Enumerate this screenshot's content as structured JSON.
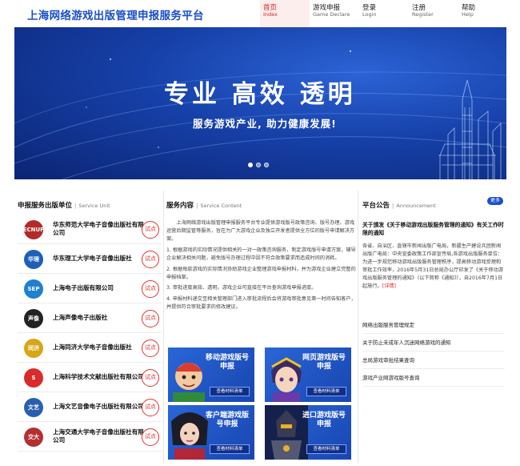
{
  "header": {
    "site_title": "上海网络游戏出版管理申报服务平台",
    "nav": [
      {
        "cn": "首页",
        "en": "Index"
      },
      {
        "cn": "游戏申报",
        "en": "Game Declare"
      },
      {
        "cn": "登录",
        "en": "Login"
      },
      {
        "cn": "注册",
        "en": "Register"
      },
      {
        "cn": "帮助",
        "en": "Help"
      }
    ]
  },
  "banner": {
    "slogan": "专业 高效 透明",
    "subtitle": "服务游戏产业, 助力健康发展!",
    "slide_count": 3,
    "active_slide": 1
  },
  "units": {
    "title_cn": "申报服务出版单位",
    "title_en": "Service Unit",
    "trial_label": "试点",
    "items": [
      {
        "name": "华东师范大学电子音像出版社有限公司",
        "logo_text": "ECNUP",
        "logo_color": "#b22b2b"
      },
      {
        "name": "华东理工大学电子音像出版社",
        "logo_text": "华理",
        "logo_color": "#1f5fb8"
      },
      {
        "name": "上海电子出版有限公司",
        "logo_text": "SEP",
        "logo_color": "#1f7fd0"
      },
      {
        "name": "上海声像电子出版社",
        "logo_text": "声像",
        "logo_color": "#222222"
      },
      {
        "name": "上海同济大学电子音像出版社",
        "logo_text": "同济",
        "logo_color": "#d8a516"
      },
      {
        "name": "上海科学技术文献出版社有限公司",
        "logo_text": "S",
        "logo_color": "#d92b2b"
      },
      {
        "name": "上海文艺音像电子出版社有限公司",
        "logo_text": "文艺",
        "logo_color": "#2a5fb0"
      },
      {
        "name": "上海交通大学电子音像出版社有限公司",
        "logo_text": "交大",
        "logo_color": "#b43030"
      }
    ]
  },
  "service": {
    "title_cn": "服务内容",
    "title_en": "Service Content",
    "intro": "上海网络游戏出版管理申报服务平台专业提供游戏版号政策咨询、版号办理、游戏运营后期监管等服务，旨在为广大游戏企业及独立开发者提供全方位的版号申请解决方案。",
    "points": [
      "1. 根据游戏的实际情况提供相关的一对一政策咨询服务，制定游戏版号申请方案，辅导企业解决相关问题，避免版号办理过程中因不符合政策要求而造成时间的消耗。",
      "2. 根据每款游戏的实际情况协助游戏企业整理游戏申报材料，并为游戏企业建立完整的申报档案。",
      "3. 审批进度高效、透明，游戏企业可直接在平台查询游戏申报进度。",
      "4. 申报材料递交至相关管理部门进入审批流程后会将游戏审批意见第一时间告知客户，并提供符合审批要求的修改建议。"
    ],
    "tiles": [
      {
        "title": "移动游戏版号申报",
        "button": "查看材料清单"
      },
      {
        "title": "网页游戏版号申报",
        "button": "查看材料清单"
      },
      {
        "title": "客户端游戏版号申报",
        "button": "查看材料清单"
      },
      {
        "title": "进口游戏版号申报",
        "button": "查看材料清单"
      }
    ]
  },
  "notices": {
    "title_cn": "平台公告",
    "title_en": "Announcement",
    "more_label": "更多",
    "featured": {
      "title": "关于颁发《关于移动游戏出版服务管理的通知》有关工作时限的通知",
      "body": "各省、自治区、直辖市新闻出版广电局，新疆生产建设兵团新闻出版广电局：中央宣委政策工作部宣传局,各游戏出版服务单位：为进一步规范移动游戏出版服务管理秩序，提高移动游戏受理和审批工作效率，2016年5月31日总局办公厅印发了《关于移动游戏出版服务管理的通知》（以下简称《通知》），自2016年7月1日起施行。",
      "detail_label": "[详情]"
    },
    "items": [
      "网络出版服务管理规定",
      "关于防止未成年人沉迷网络游戏的通知",
      "总局游戏审批结果查询",
      "游戏产业网游戏版号查询"
    ]
  }
}
